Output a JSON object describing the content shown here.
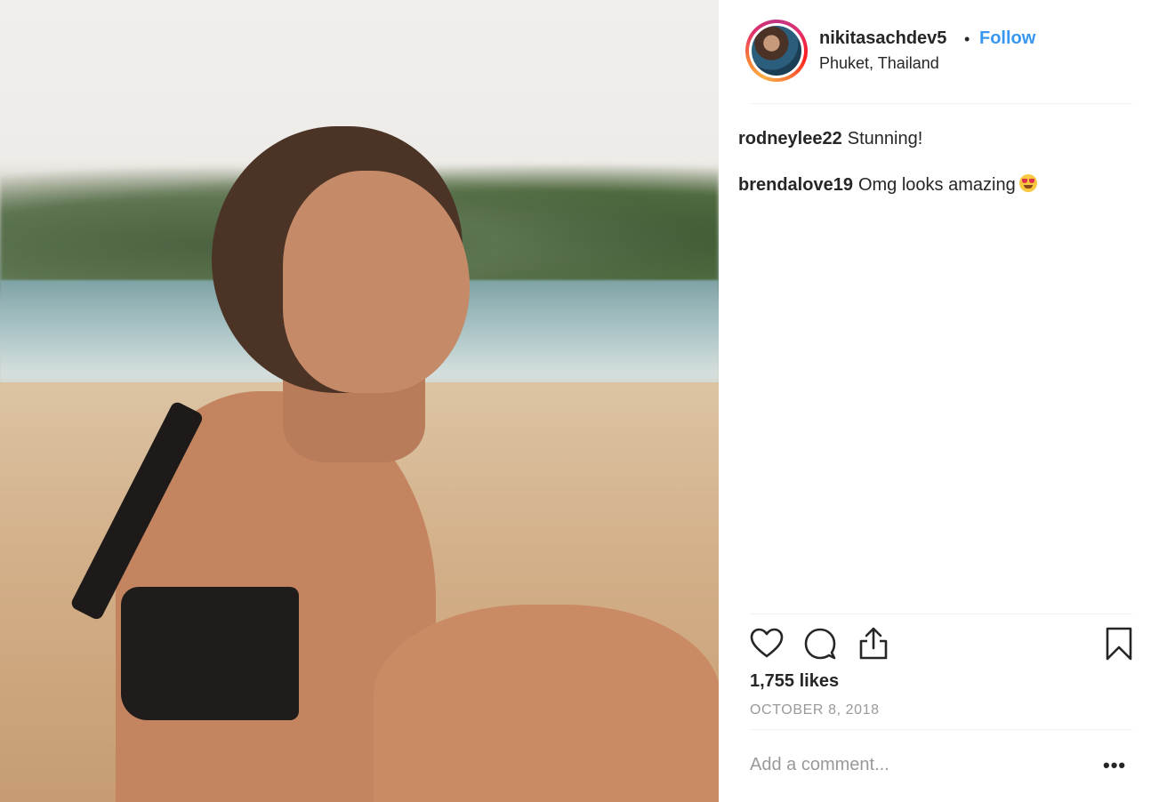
{
  "post": {
    "photo_alt": "Woman with braided hair sitting on a sandy beach looking at the sea",
    "username": "nikitasachdev5",
    "separator": "•",
    "follow_label": "Follow",
    "location": "Phuket, Thailand",
    "likes": "1,755 likes",
    "date": "OCTOBER 8, 2018",
    "comment_placeholder": "Add a comment...",
    "more_label": "•••"
  },
  "comments": [
    {
      "user": "rodneylee22",
      "text": "Stunning!"
    },
    {
      "user": "brendalove19",
      "text": "Omg looks amazing",
      "emoji": "smiling-face-with-heart-eyes"
    }
  ],
  "icons": {
    "like": "heart-icon",
    "comment": "comment-bubble-icon",
    "share": "share-icon",
    "save": "bookmark-icon"
  },
  "colors": {
    "accent": "#3897f0",
    "text": "#262626",
    "muted": "#999999",
    "divider": "#efefef"
  }
}
